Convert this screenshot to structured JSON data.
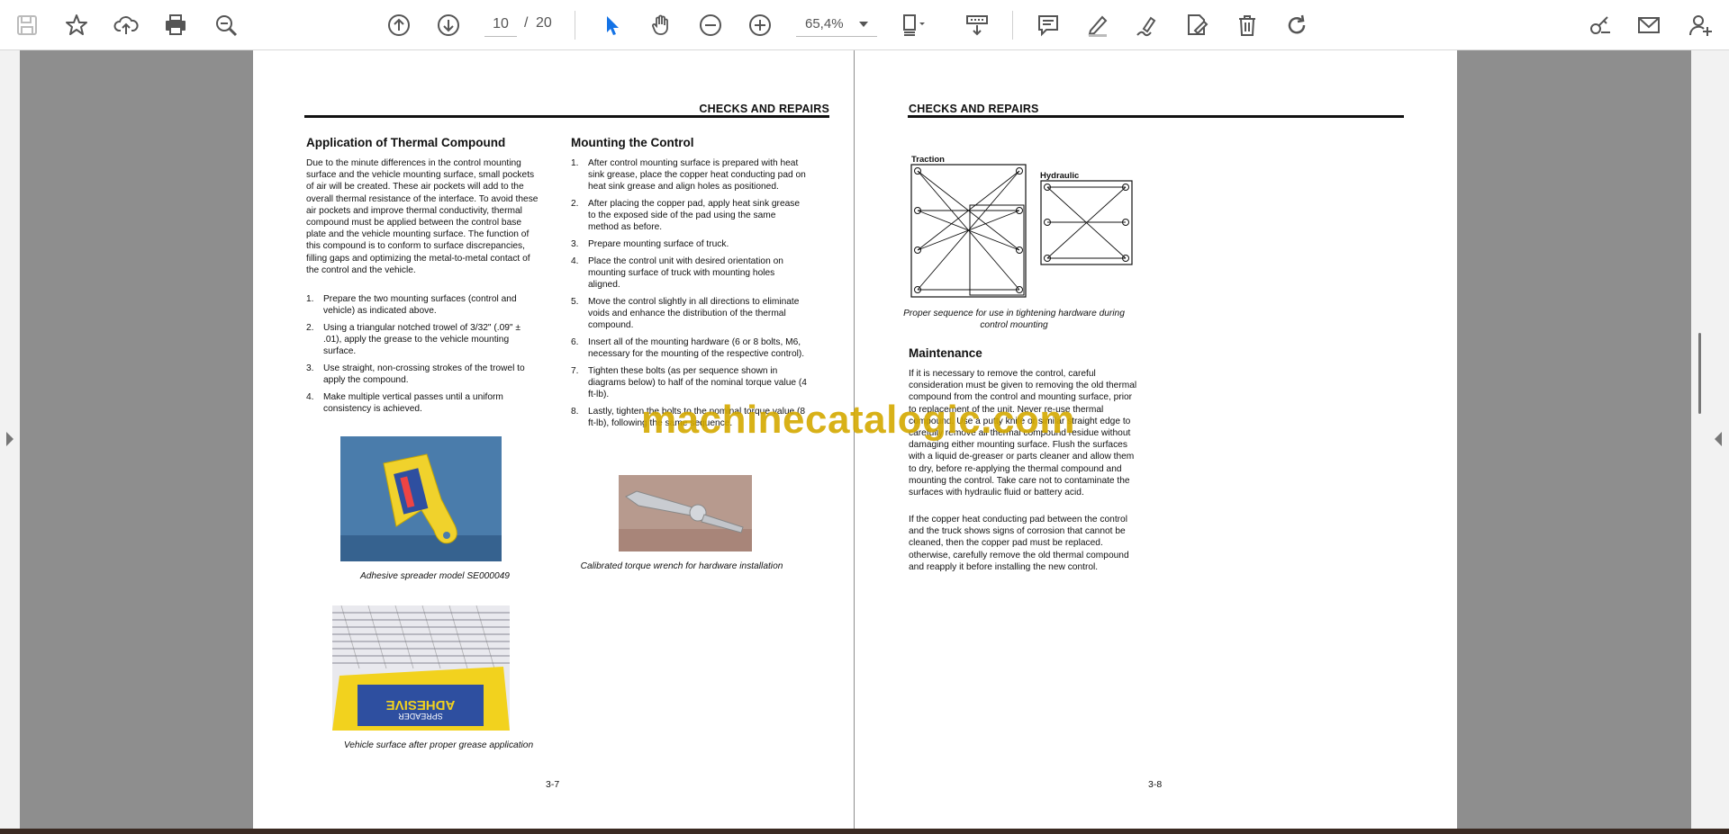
{
  "toolbar": {
    "page_current": "10",
    "page_separator": "/",
    "page_total": "20",
    "zoom": "65,4%",
    "accent_color": "#1473e6"
  },
  "left_page": {
    "header": "CHECKS AND REPAIRS",
    "col1": {
      "title": "Application of Thermal Compound",
      "paragraph": "Due to the minute differences in the control mounting surface and the vehicle mounting surface, small pockets of air will be created. These air pockets will add to the overall thermal resistance of the interface. To avoid these air pockets and improve thermal conductivity, thermal compound must be applied between the control base plate and the vehicle mounting surface. The function of this compound is to conform to surface discrepancies, filling gaps and optimizing the metal-to-metal contact of the control and the vehicle.",
      "steps": [
        {
          "num": "1.",
          "text": "Prepare the two mounting surfaces (control and vehicle) as indicated above."
        },
        {
          "num": "2.",
          "text": "Using a triangular notched trowel of 3/32\" (.09\" ± .01), apply the grease to the vehicle mounting surface."
        },
        {
          "num": "3.",
          "text": "Use straight, non-crossing strokes of the trowel to apply the compound."
        },
        {
          "num": "4.",
          "text": "Make multiple vertical passes until a uniform consistency is achieved."
        }
      ],
      "caption1": "Adhesive spreader model SE000049",
      "caption2": "Vehicle surface after proper grease application",
      "photo_label_1": "ADHESIVE",
      "photo_label_2": "SPREADER"
    },
    "col2": {
      "title": "Mounting the Control",
      "steps": [
        {
          "num": "1.",
          "text": "After control mounting surface is prepared with heat sink grease, place the copper heat conducting pad on heat sink grease and align holes as positioned."
        },
        {
          "num": "2.",
          "text": "After placing the copper pad, apply heat sink grease to the exposed side of the pad using the same method as before."
        },
        {
          "num": "3.",
          "text": "Prepare mounting surface of truck."
        },
        {
          "num": "4.",
          "text": "Place the control unit with desired orientation on mounting surface of truck with mounting holes aligned."
        },
        {
          "num": "5.",
          "text": "Move the control slightly in all directions to eliminate voids and enhance the distribution of the thermal compound."
        },
        {
          "num": "6.",
          "text": "Insert all of the mounting hardware (6 or 8 bolts, M6, necessary for the mounting of the respective control)."
        },
        {
          "num": "7.",
          "text": "Tighten these bolts (as per sequence shown in diagrams below) to half of the nominal torque value (4 ft-lb)."
        },
        {
          "num": "8.",
          "text": "Lastly, tighten the bolts to the nominal torque value (8 ft-lb), following the same sequence."
        }
      ],
      "caption": "Calibrated torque wrench for hardware installation"
    },
    "page_number": "3-7"
  },
  "right_page": {
    "header": "CHECKS AND REPAIRS",
    "diagram_traction": "Traction",
    "diagram_hydraulic": "Hydraulic",
    "diagram_caption": "Proper sequence for use in tightening hardware during control mounting",
    "maintenance_title": "Maintenance",
    "maintenance_p1": "If it is necessary to remove the control, careful consideration must be given to removing the old thermal compound from the control and mounting surface, prior to replacement of the unit. Never re-use thermal compound. Use a putty knife or similar straight edge to carefully remove all thermal compound residue without damaging either mounting surface. Flush the surfaces with a liquid de-greaser or parts cleaner and allow them to dry, before re-applying the thermal compound and mounting the control. Take care not to contaminate the surfaces with hydraulic fluid or battery acid.",
    "maintenance_p2": "If the copper heat conducting pad between the control and the truck shows signs of corrosion that cannot be cleaned, then the copper pad must be replaced. otherwise, carefully remove the old thermal compound and reapply it before installing the new control.",
    "page_number": "3-8"
  },
  "watermark": "machinecatalogic.com"
}
